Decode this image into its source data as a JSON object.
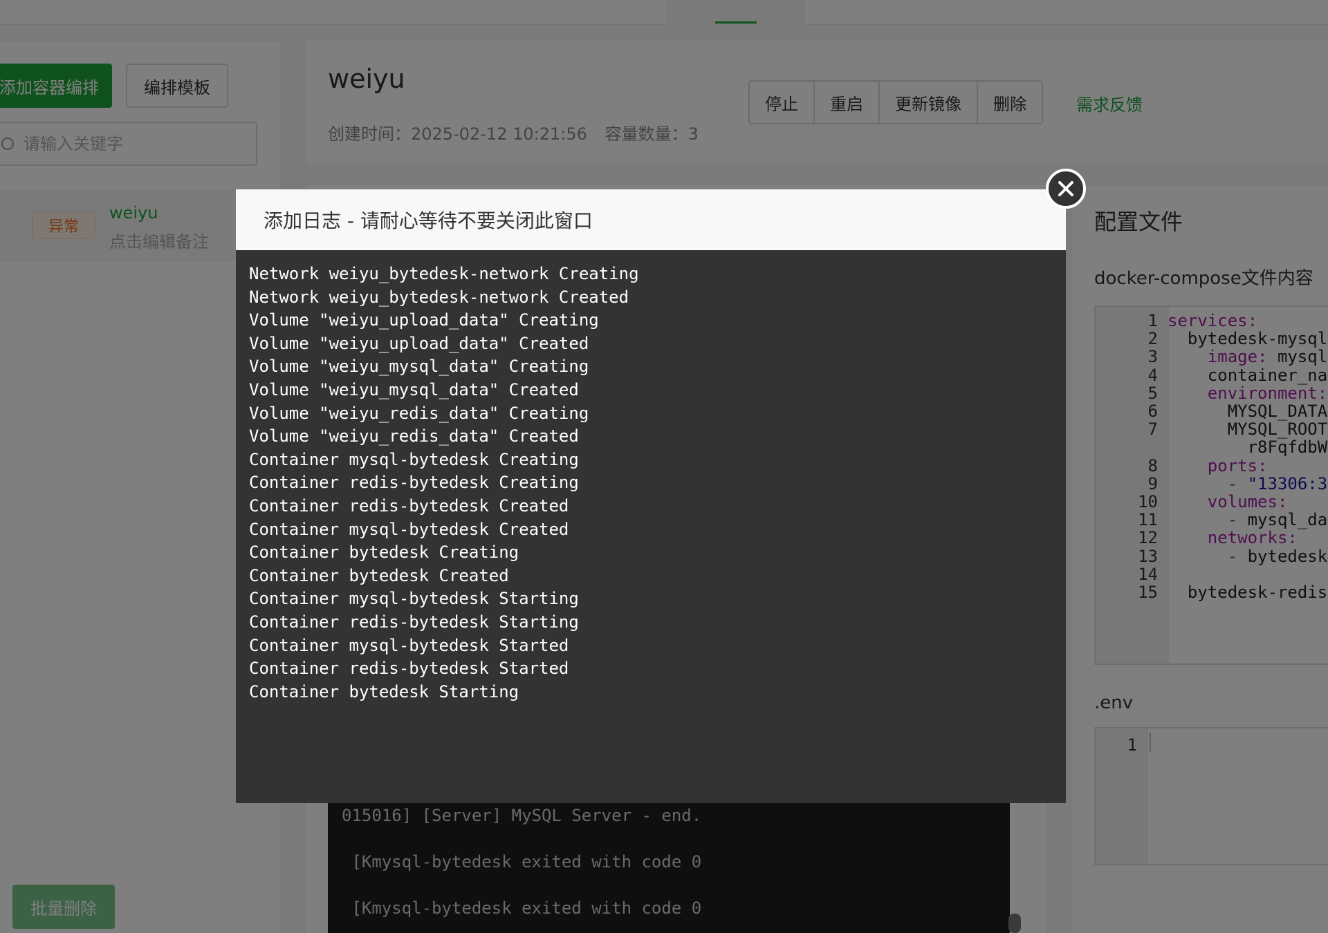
{
  "sidebar": {
    "add_button": "添加容器编排",
    "template_button": "编排模板",
    "search_placeholder": "请输入关键字",
    "item": {
      "status": "异常",
      "name": "weiyu",
      "note": "点击编辑备注"
    },
    "batch_delete": "批量删除"
  },
  "main": {
    "title": "weiyu",
    "created_label": "创建时间：2025-02-12 10:21:56",
    "count_label": "容量数量：3",
    "buttons": {
      "stop": "停止",
      "restart": "重启",
      "update_image": "更新镜像",
      "delete": "删除"
    },
    "feedback": "需求反馈"
  },
  "background_log": {
    "lines": [
      "015016] [Server] MySQL Server - end.",
      " [Kmysql-bytedesk exited with code 0",
      " [Kmysql-bytedesk exited with code 0"
    ]
  },
  "config": {
    "title": "配置文件",
    "compose_label": "docker-compose文件内容",
    "compose_lines": [
      {
        "n": "1",
        "t": "services:"
      },
      {
        "n": "2",
        "t": "  bytedesk-mysql"
      },
      {
        "n": "3",
        "t": "    image: mysql"
      },
      {
        "n": "4",
        "t": "    container_na"
      },
      {
        "n": "5",
        "t": "    environment:"
      },
      {
        "n": "6",
        "t": "      MYSQL_DATA"
      },
      {
        "n": "7",
        "t": "      MYSQL_ROOT"
      },
      {
        "n": "",
        "t": "        r8FqfdbW"
      },
      {
        "n": "8",
        "t": "    ports:"
      },
      {
        "n": "9",
        "t": "      - \"13306:3"
      },
      {
        "n": "10",
        "t": "    volumes:"
      },
      {
        "n": "11",
        "t": "      - mysql_da"
      },
      {
        "n": "12",
        "t": "    networks:"
      },
      {
        "n": "13",
        "t": "      - bytedesk"
      },
      {
        "n": "14",
        "t": ""
      },
      {
        "n": "15",
        "t": "  bytedesk-redis"
      }
    ],
    "env_label": ".env",
    "env_line_number": "1"
  },
  "modal": {
    "title": "添加日志 - 请耐心等待不要关闭此窗口",
    "log_lines": [
      "Network weiyu_bytedesk-network Creating",
      "Network weiyu_bytedesk-network Created",
      "Volume \"weiyu_upload_data\" Creating",
      "Volume \"weiyu_upload_data\" Created",
      "Volume \"weiyu_mysql_data\" Creating",
      "Volume \"weiyu_mysql_data\" Created",
      "Volume \"weiyu_redis_data\" Creating",
      "Volume \"weiyu_redis_data\" Created",
      "Container mysql-bytedesk Creating",
      "Container redis-bytedesk Creating",
      "Container redis-bytedesk Created",
      "Container mysql-bytedesk Created",
      "Container bytedesk Creating",
      "Container bytedesk Created",
      "Container mysql-bytedesk Starting",
      "Container redis-bytedesk Starting",
      "Container mysql-bytedesk Started",
      "Container redis-bytedesk Started",
      "Container bytedesk Starting"
    ]
  },
  "colors": {
    "brand": "#20a53a",
    "warning": "#f07a2b",
    "log_bg": "#333333"
  }
}
